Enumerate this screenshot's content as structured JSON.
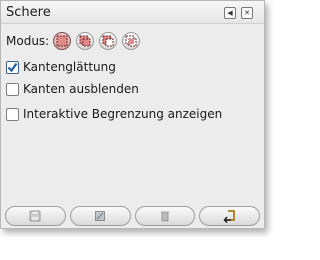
{
  "dock": {
    "title": "Schere",
    "buttons": [
      {
        "name": "menu-icon"
      },
      {
        "name": "close-icon"
      }
    ]
  },
  "options": {
    "mode_label": "Modus:",
    "modes": [
      {
        "name": "replace-mode-icon",
        "active": true
      },
      {
        "name": "add-mode-icon",
        "active": false
      },
      {
        "name": "subtract-mode-icon",
        "active": false
      },
      {
        "name": "intersect-mode-icon",
        "active": false
      }
    ],
    "antialias_label": "Kantenglättung",
    "antialias_checked": true,
    "feather_label": "Kanten ausblenden",
    "feather_checked": false,
    "interactive_label": "Interaktive Begrenzung anzeigen",
    "interactive_checked": false
  },
  "bottom_buttons": [
    {
      "name": "save-icon"
    },
    {
      "name": "restore-icon"
    },
    {
      "name": "delete-icon"
    },
    {
      "name": "reset-icon"
    }
  ],
  "colors": {
    "mode_active": "#e28a8a",
    "check": "#1f5fa8"
  }
}
